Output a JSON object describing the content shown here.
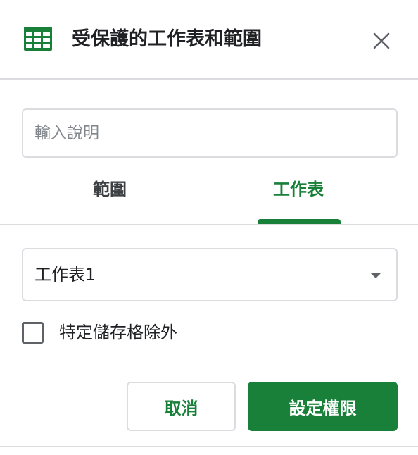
{
  "dialog": {
    "title": "受保護的工作表和範圍",
    "icon": "google-sheets-icon",
    "close_icon": "close-icon"
  },
  "description": {
    "placeholder": "輸入說明",
    "value": ""
  },
  "tabs": [
    {
      "label": "範圍",
      "active": false
    },
    {
      "label": "工作表",
      "active": true
    }
  ],
  "sheet_select": {
    "selected": "工作表1",
    "icon": "dropdown-arrow-icon"
  },
  "except_checkbox": {
    "label": "特定儲存格除外",
    "checked": false
  },
  "actions": {
    "cancel_label": "取消",
    "confirm_label": "設定權限"
  },
  "colors": {
    "accent": "#188038",
    "border": "#dadce0",
    "text": "#202124",
    "placeholder": "#80868b"
  }
}
